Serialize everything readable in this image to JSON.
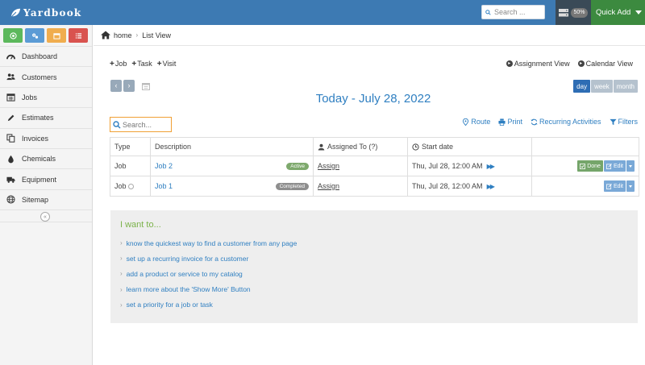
{
  "app": {
    "brand": "Yardbook"
  },
  "header": {
    "search_placeholder": "Search ...",
    "progress_badge": "50%",
    "quick_add_label": "Quick Add"
  },
  "sidebar": {
    "shortcuts": [
      {
        "icon": "globe-icon",
        "color": "#5cb85c"
      },
      {
        "icon": "cogs-icon",
        "color": "#5b9bd5"
      },
      {
        "icon": "calendar-icon",
        "color": "#f0ad4e"
      },
      {
        "icon": "list-icon",
        "color": "#d9534f"
      }
    ],
    "items": [
      {
        "label": "Dashboard",
        "icon": "dashboard-icon"
      },
      {
        "label": "Customers",
        "icon": "users-icon"
      },
      {
        "label": "Jobs",
        "icon": "calendar-icon"
      },
      {
        "label": "Estimates",
        "icon": "pencil-icon"
      },
      {
        "label": "Invoices",
        "icon": "copy-icon"
      },
      {
        "label": "Chemicals",
        "icon": "drop-icon"
      },
      {
        "label": "Equipment",
        "icon": "truck-icon"
      },
      {
        "label": "Sitemap",
        "icon": "globe-icon"
      }
    ],
    "collapse_glyph": "«"
  },
  "breadcrumb": {
    "home": "home",
    "current": "List View"
  },
  "toolbar": {
    "add_job": "Job",
    "add_task": "Task",
    "add_visit": "Visit",
    "assignment_view": "Assignment View",
    "calendar_view": "Calendar View",
    "prev": "‹",
    "next": "›",
    "ranges": [
      "day",
      "week",
      "month"
    ],
    "active_range": "day"
  },
  "title": "Today - July 28, 2022",
  "list_search_placeholder": "Search...",
  "actions": {
    "route": "Route",
    "print": "Print",
    "recurring": "Recurring Activities",
    "filters": "Filters"
  },
  "table": {
    "columns": {
      "type": "Type",
      "description": "Description",
      "assigned": "Assigned To (?)",
      "start": "Start date"
    },
    "rows": [
      {
        "type": "Job",
        "name": "Job 2",
        "status": "Active",
        "assign": "Assign",
        "start": "Thu, Jul 28, 12:00 AM",
        "done": "Done",
        "edit": "Edit"
      },
      {
        "type": "Job",
        "name": "Job 1",
        "status": "Completed",
        "assign": "Assign",
        "start": "Thu, Jul 28, 12:00 AM",
        "edit": "Edit"
      }
    ]
  },
  "want": {
    "title": "I want to...",
    "items": [
      "know the quickest way to find a customer from any page",
      "set up a recurring invoice for a customer",
      "add a product or service to my catalog",
      "learn more about the 'Show More' Button",
      "set a priority for a job or task"
    ]
  }
}
